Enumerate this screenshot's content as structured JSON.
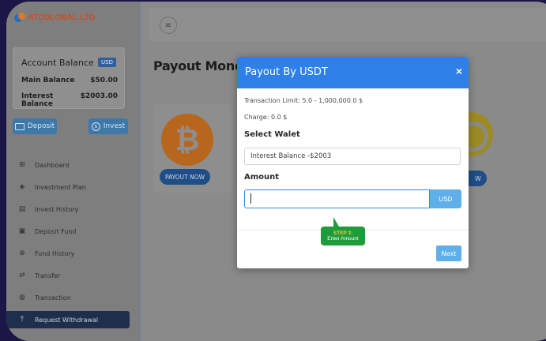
{
  "brand": {
    "name": "ATCGLOBAL LTD"
  },
  "account": {
    "title": "Account Balance",
    "currency_badge": "USD",
    "rows": [
      {
        "label": "Main Balance",
        "value": "$50.00"
      },
      {
        "label": "Interest Balance",
        "value": "$2003.00"
      }
    ]
  },
  "actions": {
    "deposit_label": "Deposit",
    "invest_label": "Invest"
  },
  "nav": {
    "items": [
      {
        "label": "Dashboard",
        "icon": "grid-icon"
      },
      {
        "label": "Investment Plan",
        "icon": "layers-icon"
      },
      {
        "label": "Invest History",
        "icon": "file-icon"
      },
      {
        "label": "Deposit Fund",
        "icon": "wallet-icon"
      },
      {
        "label": "Fund History",
        "icon": "search-dollar-icon"
      },
      {
        "label": "Transfer",
        "icon": "transfer-icon"
      },
      {
        "label": "Transaction",
        "icon": "money-bag-icon"
      },
      {
        "label": "Request Withdrawal",
        "icon": "withdraw-icon",
        "active": true
      }
    ]
  },
  "page": {
    "title": "Payout Money"
  },
  "cards": {
    "payout_label": "PAYOUT NOW",
    "payout_label_partial": "W"
  },
  "modal": {
    "title": "Payout By USDT",
    "close_symbol": "×",
    "transaction_limit": "Transaction Limit: 5.0 - 1,000,000.0 $",
    "charge": "Charge: 0.0 $",
    "select_label": "Select Walet",
    "select_value": "Interest Balance -$2003",
    "amount_label": "Amount",
    "amount_value": "",
    "amount_addon": "USD",
    "next_label": "Next"
  },
  "tooltip": {
    "step": "STEP 3:",
    "text": "Enter Amount"
  },
  "colors": {
    "modal_header": "#2f7fe8",
    "tooltip_bg": "#1f9c3a",
    "tooltip_step": "#f0c93a",
    "addon_blue": "#5fb0ea"
  }
}
